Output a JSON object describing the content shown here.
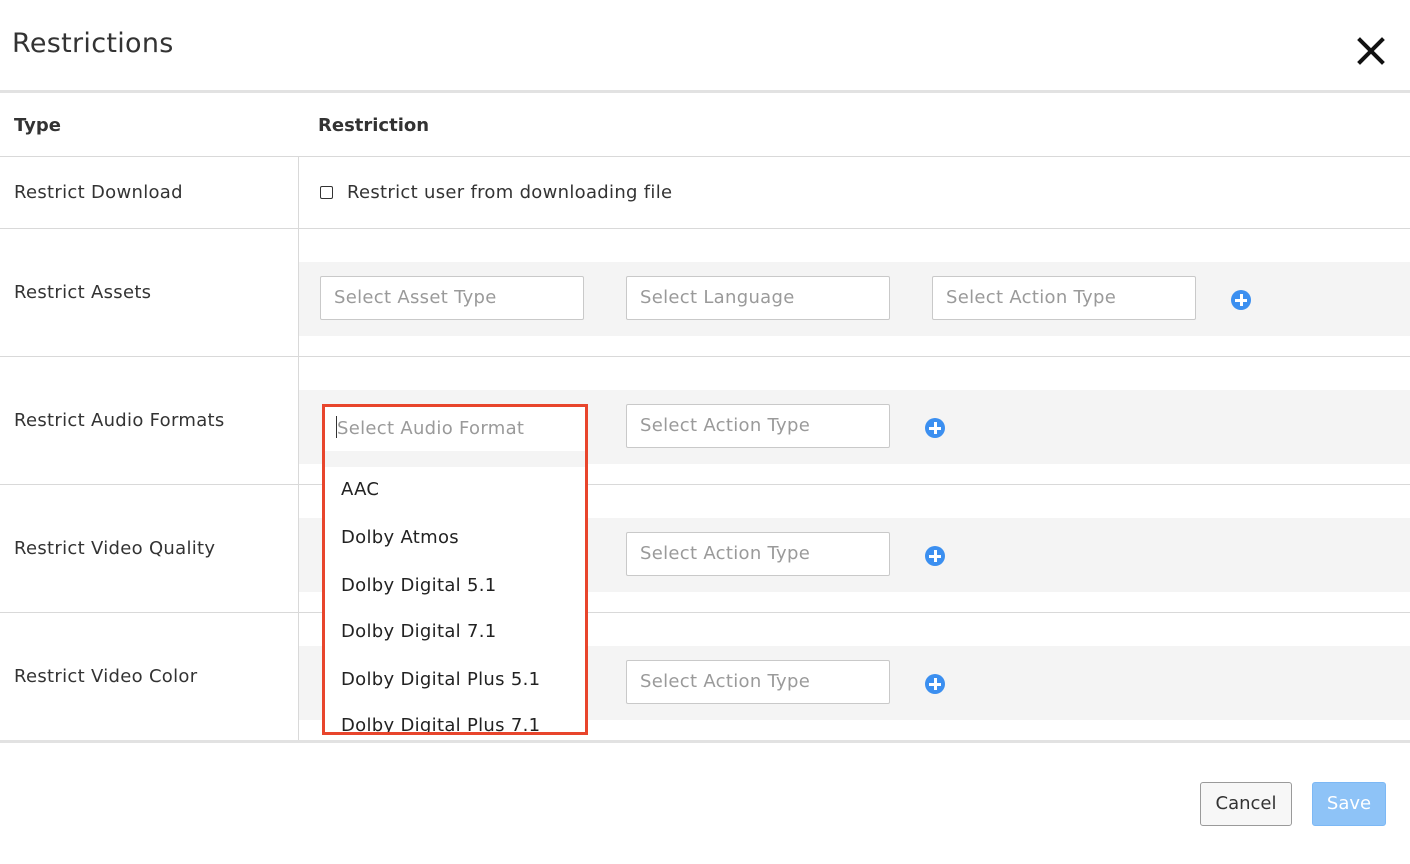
{
  "dialog": {
    "title": "Restrictions"
  },
  "table": {
    "headers": {
      "type": "Type",
      "restriction": "Restriction"
    },
    "rows": [
      {
        "label": "Restrict Download",
        "checkbox_label": "Restrict user from downloading file",
        "checked": false
      },
      {
        "label": "Restrict Assets",
        "selects": [
          "Select Asset Type",
          "Select Language",
          "Select Action Type"
        ]
      },
      {
        "label": "Restrict Audio Formats",
        "selects": [
          "Select Audio Format",
          "Select Action Type"
        ]
      },
      {
        "label": "Restrict Video Quality",
        "selects": [
          "Select Action Type"
        ]
      },
      {
        "label": "Restrict Video Color",
        "selects": [
          "Select Action Type"
        ]
      }
    ]
  },
  "audio_dropdown": {
    "placeholder": "Select Audio Format",
    "options": [
      "AAC",
      "Dolby Atmos",
      "Dolby Digital 5.1",
      "Dolby Digital 7.1",
      "Dolby Digital Plus 5.1",
      "Dolby Digital Plus 7.1"
    ]
  },
  "footer": {
    "cancel_label": "Cancel",
    "save_label": "Save"
  },
  "colors": {
    "accent": "#3b8ff0",
    "highlight_border": "#e8452c",
    "save_bg": "#8ec3f7"
  },
  "icons": {
    "close": "close-icon",
    "add": "plus-circle-icon",
    "checkbox": "checkbox-icon"
  }
}
